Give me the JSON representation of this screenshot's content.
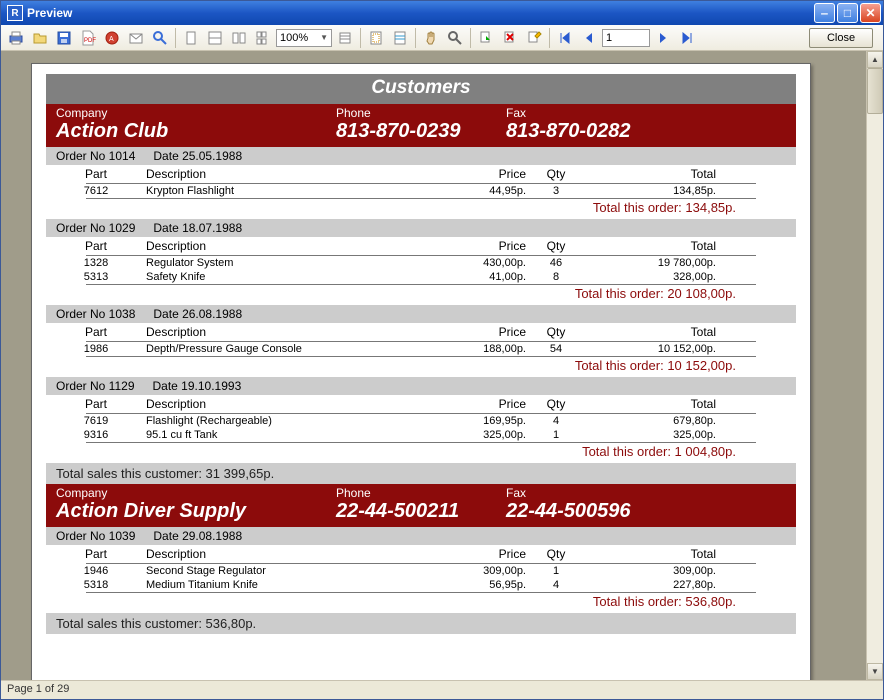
{
  "window": {
    "title": "Preview"
  },
  "toolbar": {
    "zoom": "100%",
    "page_input": "1",
    "close_label": "Close"
  },
  "statusbar": {
    "page_label": "Page 1 of 29"
  },
  "report": {
    "title": "Customers",
    "header_labels": {
      "company": "Company",
      "phone": "Phone",
      "fax": "Fax"
    },
    "table_labels": {
      "part": "Part",
      "description": "Description",
      "price": "Price",
      "qty": "Qty",
      "total": "Total"
    },
    "order_prefix": "Order No ",
    "date_prefix": "Date ",
    "order_total_prefix": "Total this order: ",
    "customer_total_prefix": "Total sales this customer: ",
    "customers": [
      {
        "company": "Action Club",
        "phone": "813-870-0239",
        "fax": "813-870-0282",
        "orders": [
          {
            "order_no": "1014",
            "date": "25.05.1988",
            "items": [
              {
                "part": "7612",
                "description": "Krypton Flashlight",
                "price": "44,95р.",
                "qty": "3",
                "total": "134,85р."
              }
            ],
            "order_total": "134,85р."
          },
          {
            "order_no": "1029",
            "date": "18.07.1988",
            "items": [
              {
                "part": "1328",
                "description": "Regulator System",
                "price": "430,00р.",
                "qty": "46",
                "total": "19 780,00р."
              },
              {
                "part": "5313",
                "description": "Safety Knife",
                "price": "41,00р.",
                "qty": "8",
                "total": "328,00р."
              }
            ],
            "order_total": "20 108,00р."
          },
          {
            "order_no": "1038",
            "date": "26.08.1988",
            "items": [
              {
                "part": "1986",
                "description": "Depth/Pressure Gauge Console",
                "price": "188,00р.",
                "qty": "54",
                "total": "10 152,00р."
              }
            ],
            "order_total": "10 152,00р."
          },
          {
            "order_no": "1129",
            "date": "19.10.1993",
            "items": [
              {
                "part": "7619",
                "description": "Flashlight (Rechargeable)",
                "price": "169,95р.",
                "qty": "4",
                "total": "679,80р."
              },
              {
                "part": "9316",
                "description": "95.1 cu ft Tank",
                "price": "325,00р.",
                "qty": "1",
                "total": "325,00р."
              }
            ],
            "order_total": "1 004,80р."
          }
        ],
        "customer_total": "31 399,65р."
      },
      {
        "company": "Action Diver Supply",
        "phone": "22-44-500211",
        "fax": "22-44-500596",
        "orders": [
          {
            "order_no": "1039",
            "date": "29.08.1988",
            "items": [
              {
                "part": "1946",
                "description": "Second Stage Regulator",
                "price": "309,00р.",
                "qty": "1",
                "total": "309,00р."
              },
              {
                "part": "5318",
                "description": "Medium Titanium Knife",
                "price": "56,95р.",
                "qty": "4",
                "total": "227,80р."
              }
            ],
            "order_total": "536,80р."
          }
        ],
        "customer_total": "536,80р."
      }
    ]
  }
}
